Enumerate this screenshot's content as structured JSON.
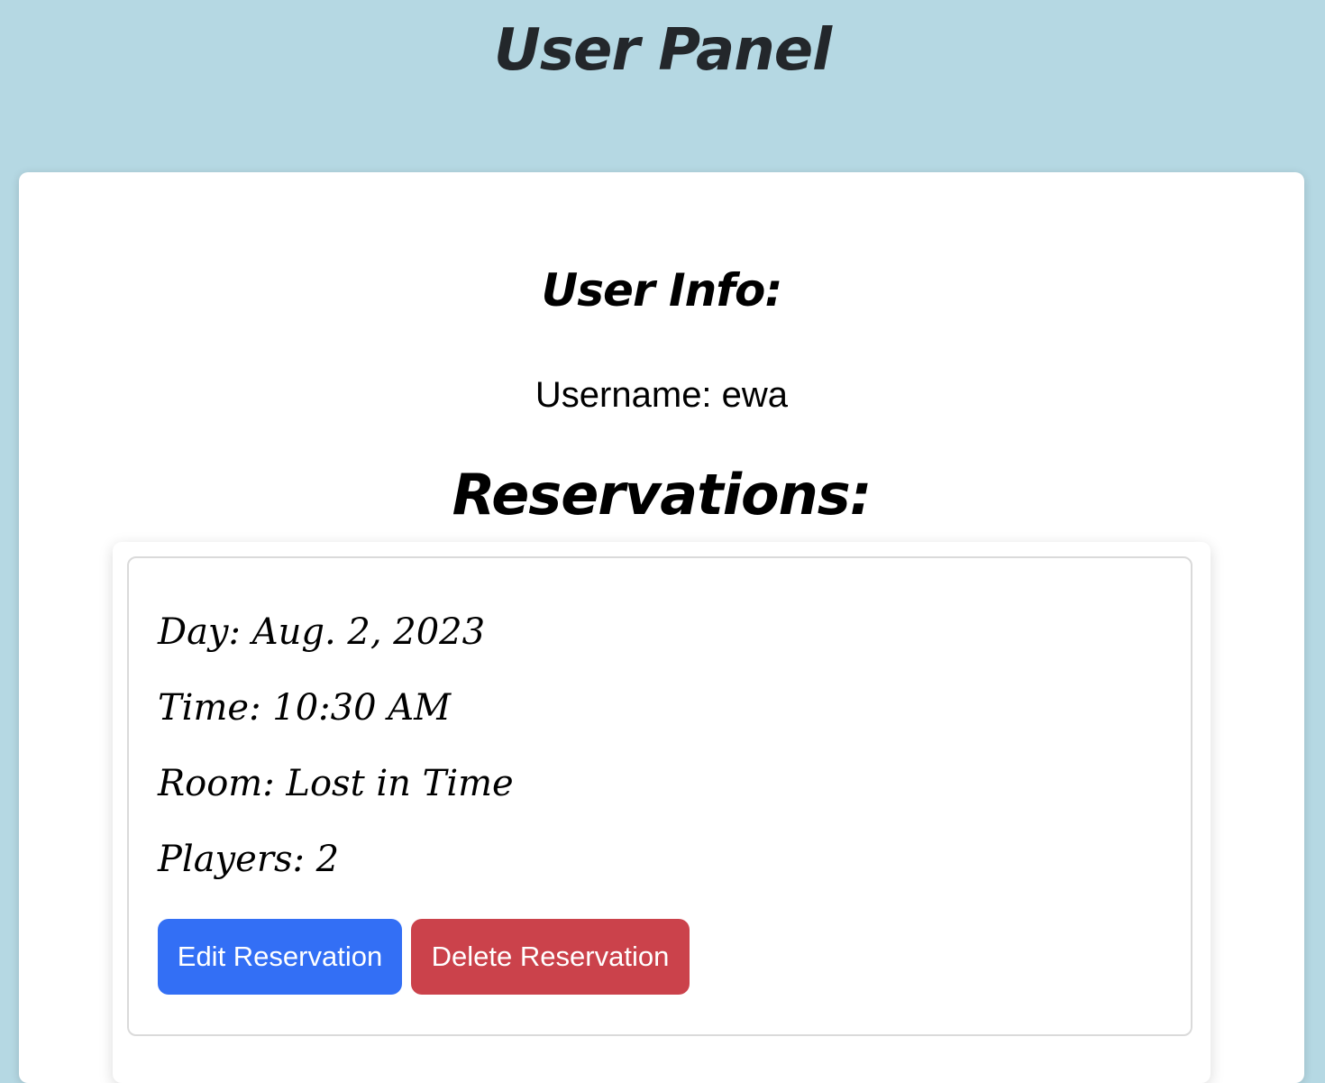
{
  "header": {
    "title": "User Panel"
  },
  "user_info": {
    "title": "User Info:",
    "username_label": "Username:",
    "username_value": "ewa"
  },
  "reservations": {
    "title": "Reservations:",
    "items": [
      {
        "day_label": "Day:",
        "day_value": "Aug. 2, 2023",
        "time_label": "Time:",
        "time_value": "10:30 AM",
        "room_label": "Room:",
        "room_value": "Lost in Time",
        "players_label": "Players:",
        "players_value": "2",
        "edit_label": "Edit Reservation",
        "delete_label": "Delete Reservation"
      }
    ]
  },
  "colors": {
    "background": "#b5d8e3",
    "edit_button": "#336ff5",
    "delete_button": "#cb424b"
  }
}
